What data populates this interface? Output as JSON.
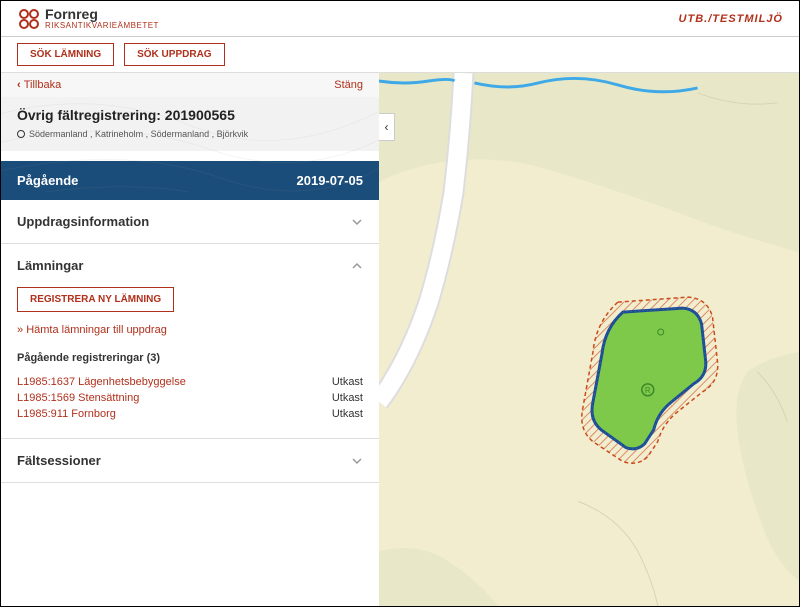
{
  "header": {
    "app_name": "Fornreg",
    "org_name": "RIKSANTIKVARIEÄMBETET",
    "env_label": "UTB./TESTMILJÖ"
  },
  "toolbar": {
    "search_remnant": "SÖK LÄMNING",
    "search_assignment": "SÖK UPPDRAG"
  },
  "nav": {
    "back": "Tillbaka",
    "close": "Stäng"
  },
  "assignment": {
    "title": "Övrig fältregistrering: 201900565",
    "location": "Södermanland , Katrineholm , Södermanland , Björkvik",
    "status": "Pågående",
    "date": "2019-07-05"
  },
  "sections": {
    "info_label": "Uppdragsinformation",
    "remnants_label": "Lämningar",
    "sessions_label": "Fältsessioner"
  },
  "remnants": {
    "register_btn": "REGISTRERA NY LÄMNING",
    "fetch_link": "Hämta lämningar till uppdrag",
    "pending_header": "Pågående registreringar (3)",
    "items": [
      {
        "label": "L1985:1637 Lägenhetsbebyggelse",
        "status": "Utkast"
      },
      {
        "label": "L1985:1569 Stensättning",
        "status": "Utkast"
      },
      {
        "label": "L1985:911 Fornborg",
        "status": "Utkast"
      }
    ]
  }
}
